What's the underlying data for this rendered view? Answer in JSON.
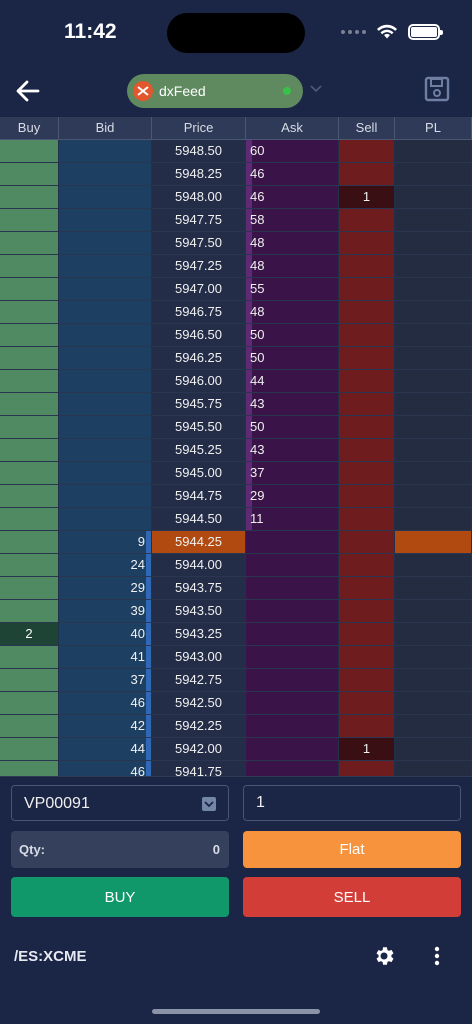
{
  "status": {
    "time": "11:42"
  },
  "header": {
    "feed_name": "dxFeed"
  },
  "ladder": {
    "columns": [
      "Buy",
      "Bid",
      "Price",
      "Ask",
      "Sell",
      "PL"
    ],
    "rows": [
      {
        "buy": "",
        "bid": "",
        "price": "5948.50",
        "ask": "60",
        "sell": "",
        "pl": ""
      },
      {
        "buy": "",
        "bid": "",
        "price": "5948.25",
        "ask": "46",
        "sell": "",
        "pl": ""
      },
      {
        "buy": "",
        "bid": "",
        "price": "5948.00",
        "ask": "46",
        "sell": "1",
        "pl": ""
      },
      {
        "buy": "",
        "bid": "",
        "price": "5947.75",
        "ask": "58",
        "sell": "",
        "pl": ""
      },
      {
        "buy": "",
        "bid": "",
        "price": "5947.50",
        "ask": "48",
        "sell": "",
        "pl": ""
      },
      {
        "buy": "",
        "bid": "",
        "price": "5947.25",
        "ask": "48",
        "sell": "",
        "pl": ""
      },
      {
        "buy": "",
        "bid": "",
        "price": "5947.00",
        "ask": "55",
        "sell": "",
        "pl": ""
      },
      {
        "buy": "",
        "bid": "",
        "price": "5946.75",
        "ask": "48",
        "sell": "",
        "pl": ""
      },
      {
        "buy": "",
        "bid": "",
        "price": "5946.50",
        "ask": "50",
        "sell": "",
        "pl": ""
      },
      {
        "buy": "",
        "bid": "",
        "price": "5946.25",
        "ask": "50",
        "sell": "",
        "pl": ""
      },
      {
        "buy": "",
        "bid": "",
        "price": "5946.00",
        "ask": "44",
        "sell": "",
        "pl": ""
      },
      {
        "buy": "",
        "bid": "",
        "price": "5945.75",
        "ask": "43",
        "sell": "",
        "pl": ""
      },
      {
        "buy": "",
        "bid": "",
        "price": "5945.50",
        "ask": "50",
        "sell": "",
        "pl": ""
      },
      {
        "buy": "",
        "bid": "",
        "price": "5945.25",
        "ask": "43",
        "sell": "",
        "pl": ""
      },
      {
        "buy": "",
        "bid": "",
        "price": "5945.00",
        "ask": "37",
        "sell": "",
        "pl": ""
      },
      {
        "buy": "",
        "bid": "",
        "price": "5944.75",
        "ask": "29",
        "sell": "",
        "pl": ""
      },
      {
        "buy": "",
        "bid": "",
        "price": "5944.50",
        "ask": "11",
        "sell": "",
        "pl": ""
      },
      {
        "buy": "",
        "bid": "9",
        "price": "5944.25",
        "ask": "",
        "sell": "",
        "pl": "",
        "last": true
      },
      {
        "buy": "",
        "bid": "24",
        "price": "5944.00",
        "ask": "",
        "sell": "",
        "pl": ""
      },
      {
        "buy": "",
        "bid": "29",
        "price": "5943.75",
        "ask": "",
        "sell": "",
        "pl": ""
      },
      {
        "buy": "",
        "bid": "39",
        "price": "5943.50",
        "ask": "",
        "sell": "",
        "pl": ""
      },
      {
        "buy": "2",
        "bid": "40",
        "price": "5943.25",
        "ask": "",
        "sell": "",
        "pl": ""
      },
      {
        "buy": "",
        "bid": "41",
        "price": "5943.00",
        "ask": "",
        "sell": "",
        "pl": ""
      },
      {
        "buy": "",
        "bid": "37",
        "price": "5942.75",
        "ask": "",
        "sell": "",
        "pl": ""
      },
      {
        "buy": "",
        "bid": "46",
        "price": "5942.50",
        "ask": "",
        "sell": "",
        "pl": ""
      },
      {
        "buy": "",
        "bid": "42",
        "price": "5942.25",
        "ask": "",
        "sell": "",
        "pl": ""
      },
      {
        "buy": "",
        "bid": "44",
        "price": "5942.00",
        "ask": "",
        "sell": "1",
        "pl": ""
      },
      {
        "buy": "",
        "bid": "46",
        "price": "5941.75",
        "ask": "",
        "sell": "",
        "pl": ""
      }
    ]
  },
  "order": {
    "account": "VP00091",
    "quantity_input": "1",
    "qty_label": "Qty:",
    "qty_value": "0",
    "flat_label": "Flat",
    "buy_label": "BUY",
    "sell_label": "SELL"
  },
  "footer": {
    "symbol": "/ES:XCME"
  },
  "colors": {
    "buy": "#10986a",
    "sell": "#d23e37",
    "flat": "#f6933c",
    "last_price": "#b04a10"
  }
}
